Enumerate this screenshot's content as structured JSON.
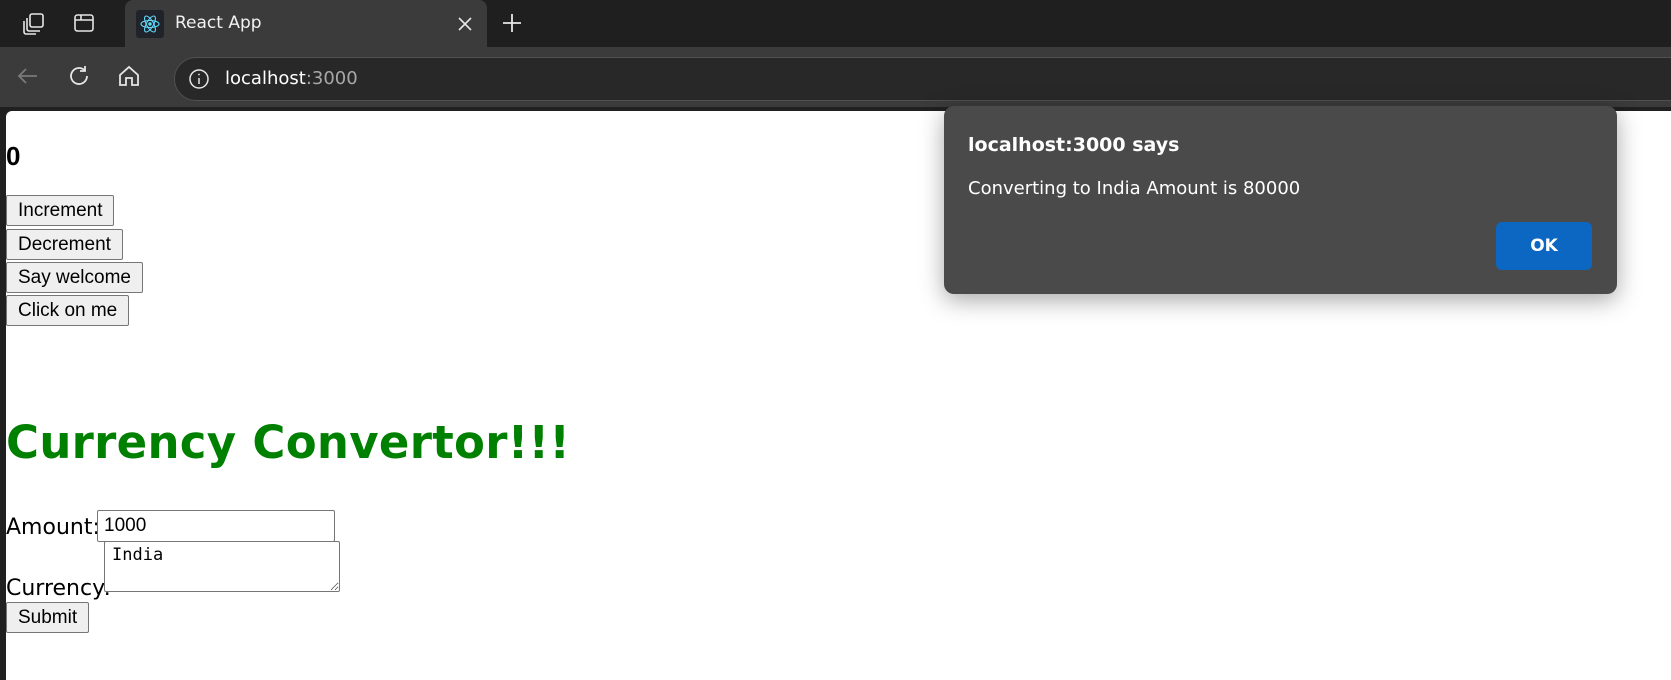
{
  "browser": {
    "tab_title": "React App",
    "url_host": "localhost",
    "url_port": ":3000",
    "icons": [
      "workspaces-icon",
      "tab-actions-icon",
      "react-logo-icon",
      "close-icon",
      "plus-icon",
      "back-icon",
      "refresh-icon",
      "home-icon",
      "info-icon"
    ]
  },
  "page": {
    "counter_value": "0",
    "buttons": {
      "increment": "Increment",
      "decrement": "Decrement",
      "say_welcome": "Say welcome",
      "click_on_me": "Click on me"
    },
    "converter": {
      "heading": "Currency Convertor!!!",
      "amount_label": "Amount:",
      "amount_value": "1000",
      "currency_label": "Currency:",
      "currency_value": "India",
      "submit_label": "Submit"
    }
  },
  "alert": {
    "title": "localhost:3000 says",
    "message": "Converting to India Amount is 80000",
    "ok_label": "OK"
  },
  "colors": {
    "heading_green": "#008000",
    "ok_button_blue": "#0b67c2",
    "dialog_background": "#4a4a4a"
  }
}
